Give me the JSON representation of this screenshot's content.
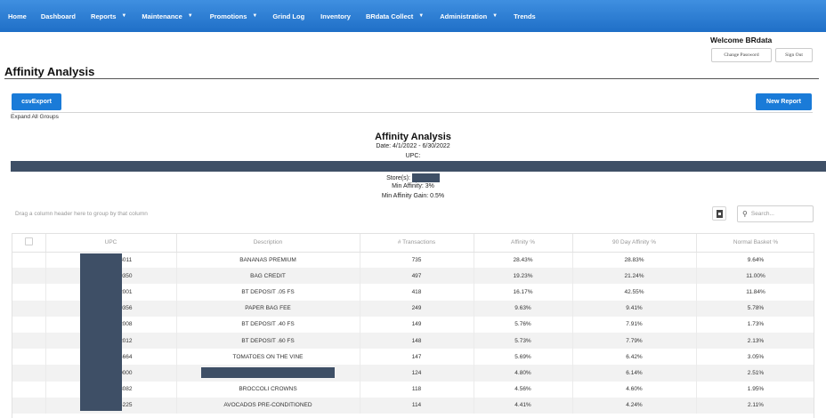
{
  "nav": {
    "items": [
      {
        "label": "Home",
        "dropdown": false
      },
      {
        "label": "Dashboard",
        "dropdown": false
      },
      {
        "label": "Reports",
        "dropdown": true
      },
      {
        "label": "Maintenance",
        "dropdown": true
      },
      {
        "label": "Promotions",
        "dropdown": true
      },
      {
        "label": "Grind Log",
        "dropdown": false
      },
      {
        "label": "Inventory",
        "dropdown": false
      },
      {
        "label": "BRdata Collect",
        "dropdown": true
      },
      {
        "label": "Administration",
        "dropdown": true
      },
      {
        "label": "Trends",
        "dropdown": false
      }
    ]
  },
  "user": {
    "welcome": "Welcome BRdata",
    "change_password": "Change Password",
    "sign_out": "Sign Out"
  },
  "page": {
    "title": "Affinity Analysis",
    "csv_export": "csvExport",
    "new_report": "New Report",
    "expand_all": "Expand All Groups"
  },
  "report": {
    "title": "Affinity Analysis",
    "date": "Date: 4/1/2022 - 6/30/2022",
    "upc_label": "UPC:",
    "store_label": "Store(s):",
    "min_affinity": "Min Affinity: 3%",
    "min_affinity_gain": "Min Affinity Gain: 0.5%"
  },
  "grid": {
    "group_hint": "Drag a column header here to group by that column",
    "search_placeholder": "Search...",
    "columns": [
      "UPC",
      "Description",
      "# Transactions",
      "Affinity %",
      "90 Day Affinity %",
      "Normal Basket %"
    ],
    "rows": [
      {
        "upc": "04011",
        "description": "BANANAS PREMIUM",
        "transactions": "735",
        "affinity": "28.43%",
        "affinity90": "28.83%",
        "normal_basket": "9.64%"
      },
      {
        "upc": "00350",
        "description": "BAG CREDIT",
        "transactions": "497",
        "affinity": "19.23%",
        "affinity90": "21.24%",
        "normal_basket": "11.00%"
      },
      {
        "upc": "02001",
        "description": "BT DEPOSIT .05 FS",
        "transactions": "418",
        "affinity": "16.17%",
        "affinity90": "42.55%",
        "normal_basket": "11.84%"
      },
      {
        "upc": "00356",
        "description": "PAPER BAG FEE",
        "transactions": "249",
        "affinity": "9.63%",
        "affinity90": "9.41%",
        "normal_basket": "5.78%"
      },
      {
        "upc": "02008",
        "description": "BT DEPOSIT .40 FS",
        "transactions": "149",
        "affinity": "5.76%",
        "affinity90": "7.91%",
        "normal_basket": "1.73%"
      },
      {
        "upc": "02012",
        "description": "BT DEPOSIT .60 FS",
        "transactions": "148",
        "affinity": "5.73%",
        "affinity90": "7.79%",
        "normal_basket": "2.13%"
      },
      {
        "upc": "04664",
        "description": "TOMATOES  ON THE VINE",
        "transactions": "147",
        "affinity": "5.69%",
        "affinity90": "6.42%",
        "normal_basket": "3.05%"
      },
      {
        "upc": "00000",
        "description": "",
        "transactions": "124",
        "affinity": "4.80%",
        "affinity90": "6.14%",
        "normal_basket": "2.51%"
      },
      {
        "upc": "03082",
        "description": "BROCCOLI CROWNS",
        "transactions": "118",
        "affinity": "4.56%",
        "affinity90": "4.60%",
        "normal_basket": "1.95%"
      },
      {
        "upc": "04225",
        "description": "AVOCADOS PRE-CONDITIONED",
        "transactions": "114",
        "affinity": "4.41%",
        "affinity90": "4.24%",
        "normal_basket": "2.11%"
      }
    ]
  },
  "colors": {
    "nav_top": "#3f8fe0",
    "nav_bottom": "#1f6fc7",
    "button_blue": "#1a7bd8",
    "redaction": "#3e4f66",
    "row_alt": "#f2f2f2"
  }
}
